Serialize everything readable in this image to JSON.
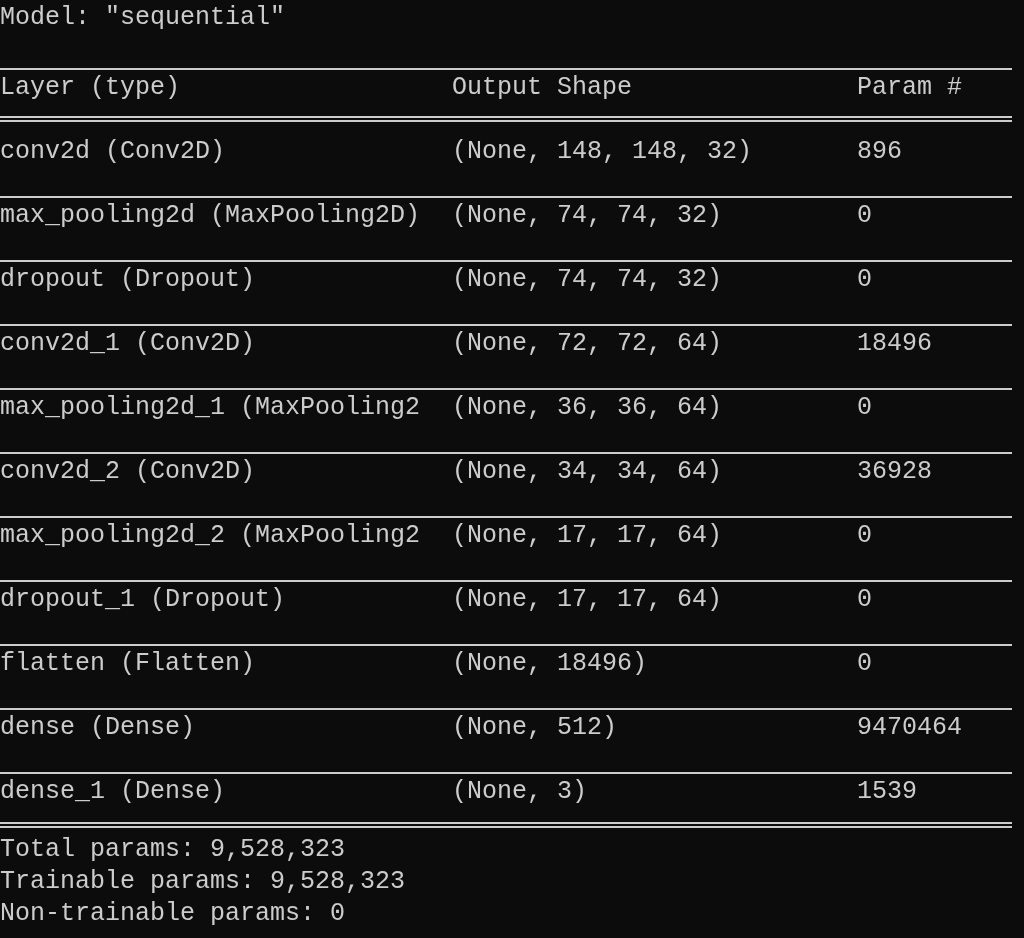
{
  "title": "Model: \"sequential\"",
  "table": {
    "columns": [
      "Layer (type)",
      "Output Shape",
      "Param #"
    ],
    "rows": [
      {
        "layer": "conv2d (Conv2D)",
        "output_shape": "(None, 148, 148, 32)",
        "param": "896"
      },
      {
        "layer": "max_pooling2d (MaxPooling2D)",
        "output_shape": "(None, 74, 74, 32)",
        "param": "0"
      },
      {
        "layer": "dropout (Dropout)",
        "output_shape": "(None, 74, 74, 32)",
        "param": "0"
      },
      {
        "layer": "conv2d_1 (Conv2D)",
        "output_shape": "(None, 72, 72, 64)",
        "param": "18496"
      },
      {
        "layer": "max_pooling2d_1 (MaxPooling2",
        "output_shape": "(None, 36, 36, 64)",
        "param": "0"
      },
      {
        "layer": "conv2d_2 (Conv2D)",
        "output_shape": "(None, 34, 34, 64)",
        "param": "36928"
      },
      {
        "layer": "max_pooling2d_2 (MaxPooling2",
        "output_shape": "(None, 17, 17, 64)",
        "param": "0"
      },
      {
        "layer": "dropout_1 (Dropout)",
        "output_shape": "(None, 17, 17, 64)",
        "param": "0"
      },
      {
        "layer": "flatten (Flatten)",
        "output_shape": "(None, 18496)",
        "param": "0"
      },
      {
        "layer": "dense (Dense)",
        "output_shape": "(None, 512)",
        "param": "9470464"
      },
      {
        "layer": "dense_1 (Dense)",
        "output_shape": "(None, 3)",
        "param": "1539"
      }
    ]
  },
  "summary": [
    "Total params: 9,528,323",
    "Trainable params: 9,528,323",
    "Non-trainable params: 0"
  ]
}
